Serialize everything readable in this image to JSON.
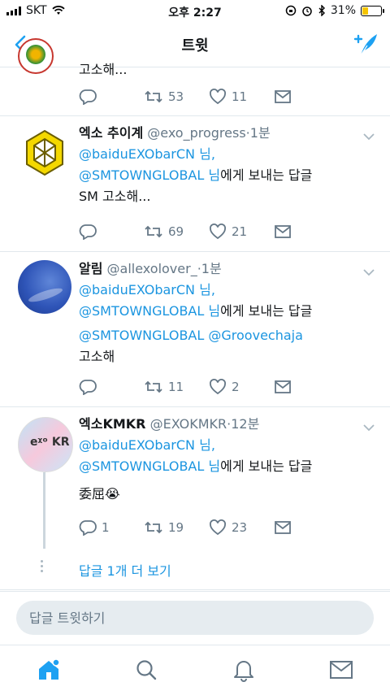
{
  "status": {
    "carrier": "SKT",
    "time": "오후 2:27",
    "battery": "31%",
    "battery_level": 0.31
  },
  "nav": {
    "title": "트윗"
  },
  "colors": {
    "link": "#1b95e0",
    "muted": "#657786",
    "divider": "#e1e8ed"
  },
  "tweets": [
    {
      "text_tail": "고소해...",
      "reply_count": "",
      "retweet_count": "53",
      "like_count": "11"
    },
    {
      "name": "엑소 추이계",
      "handle": "@exo_progress",
      "sep": "·",
      "time": "1분",
      "mention1": "@baiduEXObarCN",
      "mention1_suffix": " 님,",
      "mention2": "@SMTOWNGLOBAL",
      "mention2_suffix": " 님",
      "reply_label": "에게 보내는 답글",
      "text": "SM 고소해...",
      "reply_count": "",
      "retweet_count": "69",
      "like_count": "21"
    },
    {
      "name": "알림",
      "handle": "@allexolover_",
      "sep": "·",
      "time": "1분",
      "mention1": "@baiduEXObarCN",
      "mention1_suffix": " 님,",
      "mention2": "@SMTOWNGLOBAL",
      "mention2_suffix": " 님",
      "reply_label": "에게 보내는 답글",
      "text_link1": "@SMTOWNGLOBAL",
      "text_link2": "@Groovechaja",
      "text": "고소해",
      "reply_count": "",
      "retweet_count": "11",
      "like_count": "2"
    },
    {
      "name": "엑소KMKR",
      "handle": "@EXOKMKR",
      "sep": "·",
      "time": "12분",
      "mention1": "@baiduEXObarCN",
      "mention1_suffix": " 님,",
      "mention2": "@SMTOWNGLOBAL",
      "mention2_suffix": " 님",
      "reply_label": "에게 보내는 답글",
      "text": "委屈😭",
      "reply_count": "1",
      "retweet_count": "19",
      "like_count": "23"
    }
  ],
  "more_replies": "답글 1개 더 보기",
  "reply_box": {
    "placeholder": "답글 트윗하기"
  },
  "tabs": [
    {
      "icon": "home-icon"
    },
    {
      "icon": "search-icon"
    },
    {
      "icon": "bell-icon"
    },
    {
      "icon": "mail-icon"
    }
  ]
}
